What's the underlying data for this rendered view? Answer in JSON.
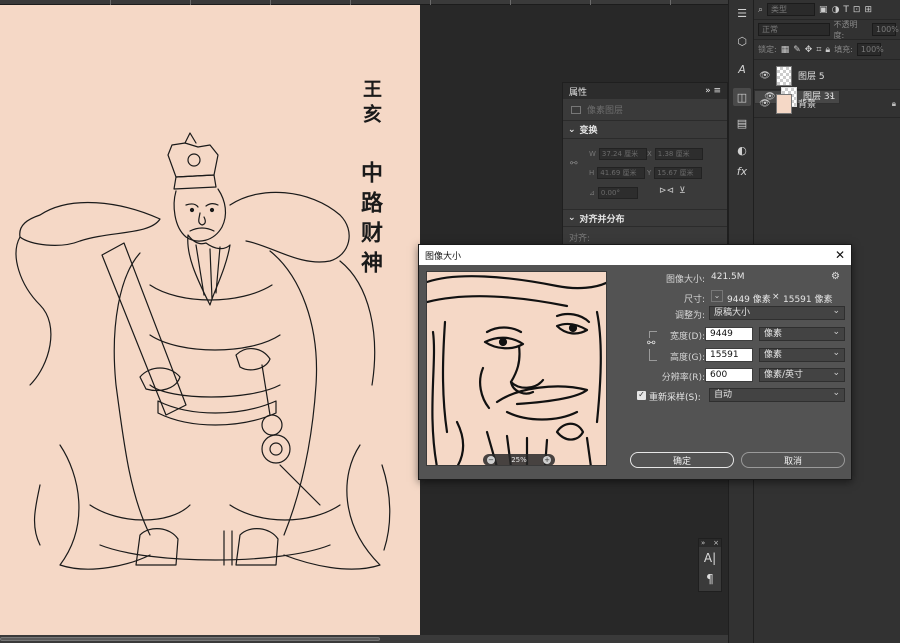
{
  "artwork": {
    "title_top": "王亥",
    "title_main": "中路财神",
    "background_color": "#f5d8c6"
  },
  "right_strip": {
    "icons": [
      "adjust-sliders-icon",
      "3d-cube-icon",
      "glyph-a-icon",
      "layers-icon",
      "properties-icon",
      "circle-half-icon",
      "fx-icon"
    ]
  },
  "layers_panel": {
    "filter_placeholder": "类型",
    "blend_mode": "正常",
    "opacity_label": "不透明度:",
    "opacity_value": "100%",
    "lock_label": "锁定:",
    "fill_label": "填充:",
    "fill_value": "100%",
    "layers": [
      {
        "name": "图层 5",
        "selected": false,
        "thumb": "checker"
      },
      {
        "name": "图层 31",
        "selected": true,
        "thumb": "checker"
      },
      {
        "name": "背景",
        "selected": false,
        "thumb": "background",
        "locked": true
      }
    ]
  },
  "properties_panel": {
    "title": "属性",
    "layer_type": "像素图层",
    "transform_section": "变换",
    "w_label": "W",
    "w_value": "37.24 厘米",
    "x_label": "X",
    "x_value": "1.38 厘米",
    "h_label": "H",
    "h_value": "41.69 厘米",
    "y_label": "Y",
    "y_value": "15.67 厘米",
    "angle_value": "0.00°",
    "align_section": "对齐并分布",
    "align_label": "对齐:"
  },
  "image_size_dialog": {
    "title": "图像大小",
    "image_size_label": "图像大小:",
    "image_size_value": "421.5M",
    "dimensions_label": "尺寸:",
    "dim_width": "9449 像素",
    "dim_times": "×",
    "dim_height": "15591 像素",
    "fit_label": "调整为:",
    "fit_value": "原稿大小",
    "width_label": "宽度(D):",
    "width_value": "9449",
    "width_unit": "像素",
    "height_label": "高度(G):",
    "height_value": "15591",
    "height_unit": "像素",
    "resolution_label": "分辨率(R):",
    "resolution_value": "600",
    "resolution_unit": "像素/英寸",
    "resample_label": "重新采样(S):",
    "resample_checked": true,
    "resample_value": "自动",
    "zoom_value": "25%",
    "ok_label": "确定",
    "cancel_label": "取消"
  }
}
